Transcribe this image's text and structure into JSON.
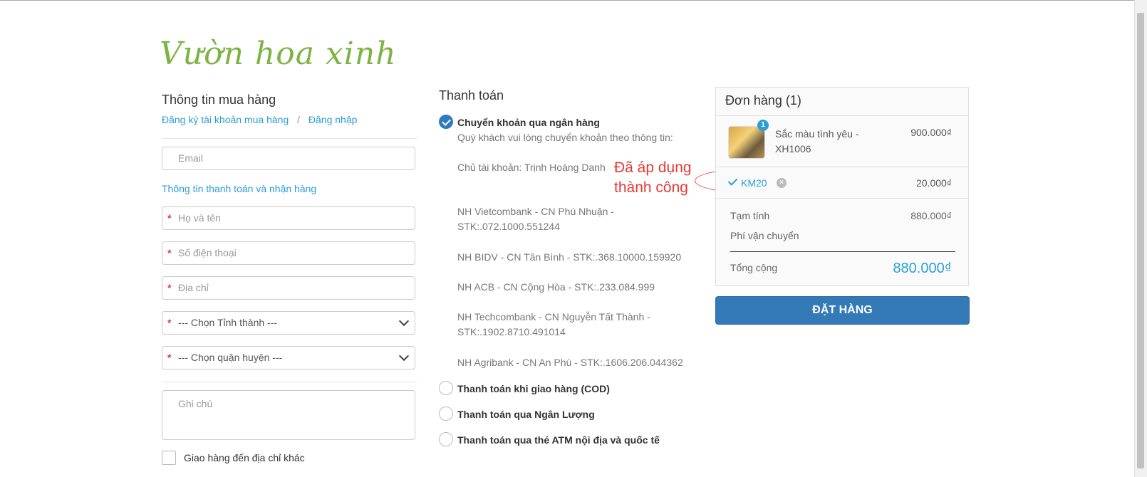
{
  "logo": {
    "text": "Vườn hoa xinh"
  },
  "buyer": {
    "title": "Thông tin mua hàng",
    "register_link": "Đăng ký tài khoản mua hàng",
    "separator": "/",
    "login_link": "Đăng nhập",
    "email_placeholder": "Email",
    "info_link": "Thông tin thanh toán và nhận hàng",
    "name_placeholder": "Họ và tên",
    "phone_placeholder": "Số điện thoại",
    "address_placeholder": "Địa chỉ",
    "province_select": "--- Chọn Tỉnh thành ---",
    "district_select": "--- Chọn quận huyện ---",
    "note_placeholder": "Ghi chú",
    "other_address_label": "Giao hàng đến địa chỉ khác",
    "required_mark": "*"
  },
  "payment": {
    "title": "Thanh toán",
    "methods": [
      {
        "label": "Chuyển khoản qua ngân hàng",
        "checked": true
      },
      {
        "label": "Thanh toán khi giao hàng (COD)",
        "checked": false
      },
      {
        "label": "Thanh toán qua Ngân Lượng",
        "checked": false
      },
      {
        "label": "Thanh toán qua thẻ ATM nội địa và quốc tế",
        "checked": false
      }
    ],
    "instructions": "Quý khách vui lòng chuyển khoản theo thông tin:",
    "account_holder": "Chủ tài khoản: Trịnh Hoàng Danh",
    "banks": [
      "NH Vietcombank - CN Phú Nhuận - STK:.072.1000.551244",
      "NH BIDV - CN Tân Bình - STK:.368.10000.159920",
      "NH ACB - CN Cộng Hòa - STK:.233.084.999",
      "NH Techcombank - CN Nguyễn Tất Thành - STK:.1902.8710.491014",
      "NH Agribank - CN An Phú - STK:.1606.206.044362"
    ]
  },
  "annotation": {
    "line1": "Đã áp dụng",
    "line2": "thành công"
  },
  "order": {
    "title": "Đơn hàng (1)",
    "item": {
      "name": "Sắc màu tình yêu - XH1006",
      "price": "900.000₫",
      "qty": "1"
    },
    "coupon": {
      "code": "KM20",
      "discount": "20.000₫",
      "remove_icon": "x-icon"
    },
    "subtotal_label": "Tạm tính",
    "subtotal_value": "880.000₫",
    "shipping_label": "Phí vận chuyển",
    "total_label": "Tổng cộng",
    "total_value": "880.000₫",
    "place_order": "ĐẶT HÀNG"
  },
  "colors": {
    "accent": "#2a9fd6",
    "button": "#337ab7",
    "annotation": "#e53935",
    "logo": "#7cb342"
  }
}
